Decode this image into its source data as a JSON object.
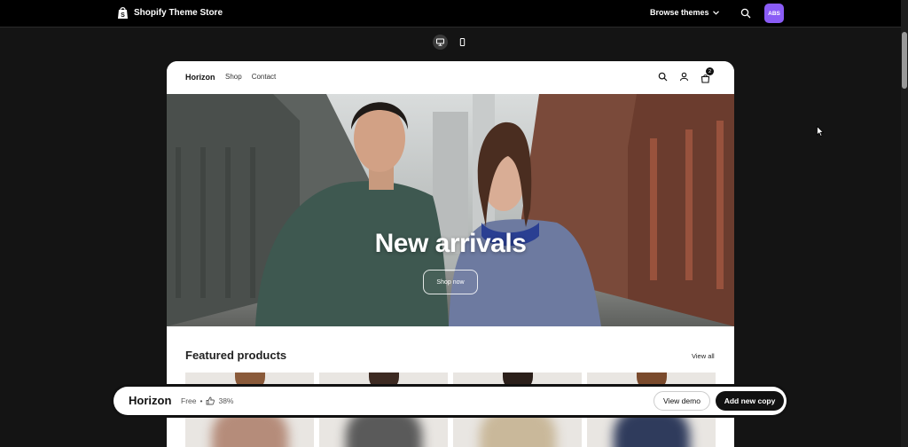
{
  "topbar": {
    "brand": "Shopify Theme Store",
    "browse_label": "Browse themes",
    "avatar_initials": "ABS"
  },
  "device_toggle": [
    "desktop-icon",
    "mobile-icon"
  ],
  "store": {
    "logo": "Horizon",
    "nav": [
      "Shop",
      "Contact"
    ],
    "cart_count": "2",
    "hero_title": "New arrivals",
    "hero_button": "Shop now",
    "featured_title": "Featured products",
    "view_all": "View all"
  },
  "bottom_bar": {
    "theme_name": "Horizon",
    "price": "Free",
    "separator": "•",
    "rating": "38%",
    "view_demo": "View demo",
    "add_copy": "Add new copy"
  },
  "colors": {
    "background": "#141414",
    "avatar": "#8a5cf6",
    "primary_button": "#111111"
  }
}
